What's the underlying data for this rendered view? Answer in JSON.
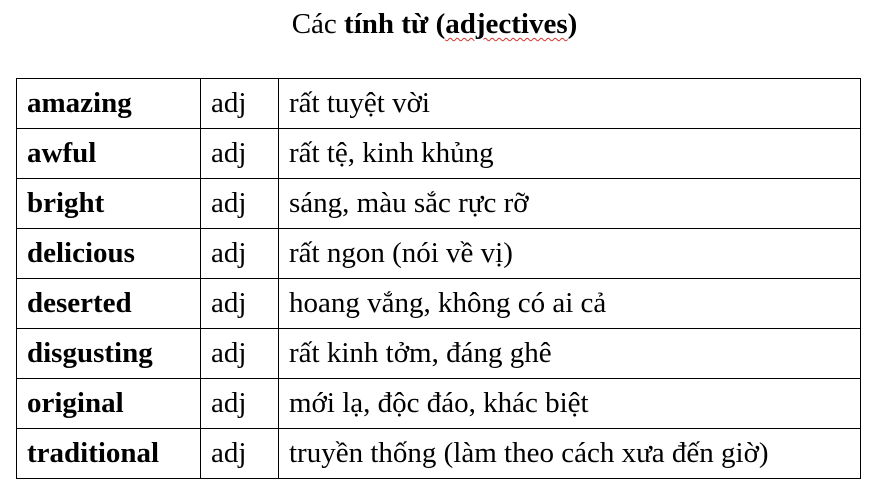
{
  "title": {
    "prefix": "Các ",
    "bold_text": "tính từ ",
    "bold_paren_open": "(",
    "bold_squiggle": "adjectives",
    "bold_paren_close": ")"
  },
  "rows": [
    {
      "word": "amazing",
      "pos": "adj",
      "meaning": "rất tuyệt vời"
    },
    {
      "word": "awful",
      "pos": "adj",
      "meaning": "rất tệ, kinh khủng"
    },
    {
      "word": "bright",
      "pos": "adj",
      "meaning": "sáng, màu sắc rực rỡ"
    },
    {
      "word": "delicious",
      "pos": "adj",
      "meaning": "rất ngon (nói về vị)"
    },
    {
      "word": "deserted",
      "pos": "adj",
      "meaning": "hoang vắng, không có ai cả"
    },
    {
      "word": "disgusting",
      "pos": "adj",
      "meaning": "rất kinh tởm, đáng ghê"
    },
    {
      "word": "original",
      "pos": "adj",
      "meaning": "mới lạ, độc đáo, khác biệt"
    },
    {
      "word": "traditional",
      "pos": "adj",
      "meaning": "truyền thống (làm theo cách xưa đến giờ)"
    }
  ]
}
